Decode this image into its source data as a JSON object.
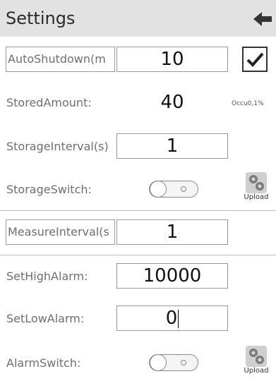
{
  "header": {
    "title": "Settings"
  },
  "auto_shutdown": {
    "label": "AutoShutdown(m",
    "value": "10",
    "checked": true
  },
  "stored_amount": {
    "label": "StoredAmount:",
    "value": "40",
    "occupancy": "Occu0,1%"
  },
  "storage_interval": {
    "label": "StorageInterval(s)",
    "value": "1"
  },
  "storage_switch": {
    "label": "StorageSwitch:",
    "on": false,
    "upload_label": "Upload"
  },
  "measure_interval": {
    "label": "MeasureInterval(s",
    "value": "1"
  },
  "set_high_alarm": {
    "label": "SetHighAlarm:",
    "value": "10000"
  },
  "set_low_alarm": {
    "label": "SetLowAlarm:",
    "value": "0"
  },
  "alarm_switch": {
    "label": "AlarmSwitch:",
    "on": false,
    "upload_label": "Upload"
  }
}
